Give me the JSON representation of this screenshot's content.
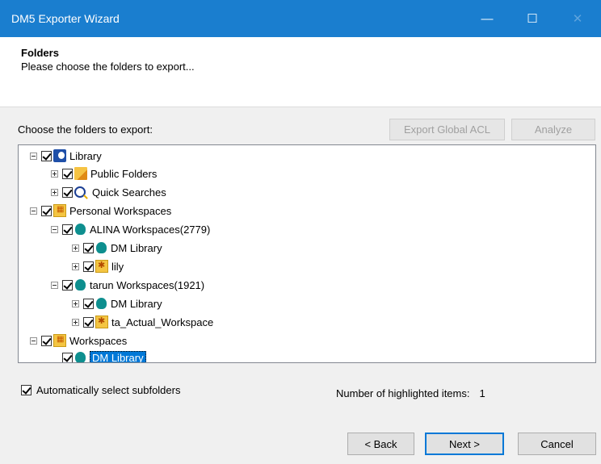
{
  "window": {
    "title": "DM5 Exporter Wizard"
  },
  "header": {
    "title": "Folders",
    "subtitle": "Please choose the folders to export..."
  },
  "main": {
    "choose_label": "Choose the folders to export:",
    "export_acl_label": "Export Global ACL",
    "analyze_label": "Analyze"
  },
  "tree": {
    "library": "Library",
    "public_folders": "Public Folders",
    "quick_searches": "Quick Searches",
    "personal_workspaces": "Personal Workspaces",
    "alina_workspaces": "ALINA Workspaces(2779)",
    "alina_dm_library": "DM Library",
    "alina_lily": "lily",
    "tarun_workspaces": "tarun Workspaces(1921)",
    "tarun_dm_library": "DM Library",
    "tarun_actual": "ta_Actual_Workspace",
    "workspaces": "Workspaces",
    "ws_dm_library": "DM Library"
  },
  "options": {
    "auto_select_label": "Automatically select subfolders",
    "highlighted_label": "Number of highlighted items:",
    "highlighted_count": "1"
  },
  "footer": {
    "back_label": "< Back",
    "next_label": "Next >",
    "cancel_label": "Cancel"
  },
  "colors": {
    "titlebar": "#1a7ecf",
    "selection": "#0078d7"
  }
}
